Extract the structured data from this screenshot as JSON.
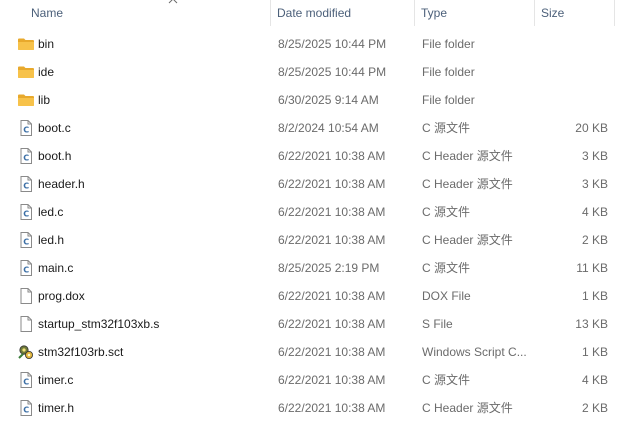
{
  "columns": {
    "name": "Name",
    "date": "Date modified",
    "type": "Type",
    "size": "Size"
  },
  "files": [
    {
      "name": "bin",
      "date": "8/25/2025 10:44 PM",
      "type": "File folder",
      "size": "",
      "icon": "folder-icon"
    },
    {
      "name": "ide",
      "date": "8/25/2025 10:44 PM",
      "type": "File folder",
      "size": "",
      "icon": "folder-icon"
    },
    {
      "name": "lib",
      "date": "6/30/2025 9:14 AM",
      "type": "File folder",
      "size": "",
      "icon": "folder-icon"
    },
    {
      "name": "boot.c",
      "date": "8/2/2024 10:54 AM",
      "type": "C 源文件",
      "size": "20 KB",
      "icon": "c-file-icon"
    },
    {
      "name": "boot.h",
      "date": "6/22/2021 10:38 AM",
      "type": "C Header 源文件",
      "size": "3 KB",
      "icon": "c-file-icon"
    },
    {
      "name": "header.h",
      "date": "6/22/2021 10:38 AM",
      "type": "C Header 源文件",
      "size": "3 KB",
      "icon": "c-file-icon"
    },
    {
      "name": "led.c",
      "date": "6/22/2021 10:38 AM",
      "type": "C 源文件",
      "size": "4 KB",
      "icon": "c-file-icon"
    },
    {
      "name": "led.h",
      "date": "6/22/2021 10:38 AM",
      "type": "C Header 源文件",
      "size": "2 KB",
      "icon": "c-file-icon"
    },
    {
      "name": "main.c",
      "date": "8/25/2025 2:19 PM",
      "type": "C 源文件",
      "size": "11 KB",
      "icon": "c-file-icon"
    },
    {
      "name": "prog.dox",
      "date": "6/22/2021 10:38 AM",
      "type": "DOX File",
      "size": "1 KB",
      "icon": "blank-file-icon"
    },
    {
      "name": "startup_stm32f103xb.s",
      "date": "6/22/2021 10:38 AM",
      "type": "S File",
      "size": "13 KB",
      "icon": "blank-file-icon"
    },
    {
      "name": "stm32f103rb.sct",
      "date": "6/22/2021 10:38 AM",
      "type": "Windows Script C...",
      "size": "1 KB",
      "icon": "script-file-icon"
    },
    {
      "name": "timer.c",
      "date": "6/22/2021 10:38 AM",
      "type": "C 源文件",
      "size": "4 KB",
      "icon": "c-file-icon"
    },
    {
      "name": "timer.h",
      "date": "6/22/2021 10:38 AM",
      "type": "C Header 源文件",
      "size": "2 KB",
      "icon": "c-file-icon"
    }
  ],
  "colors": {
    "folder": "#f7c24a",
    "header_text": "#4c607a",
    "c_letter": "#3a6ea5"
  }
}
